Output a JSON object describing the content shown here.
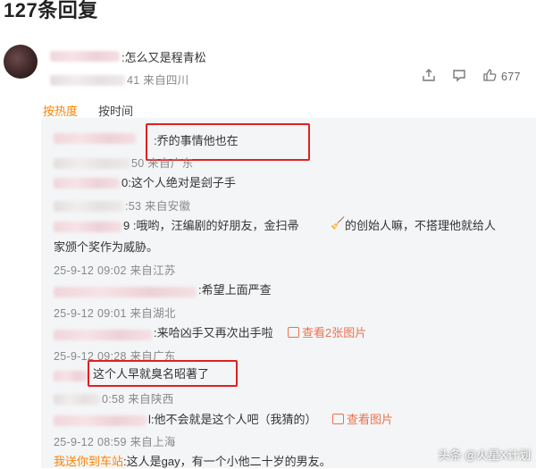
{
  "header": {
    "title": "127条回复"
  },
  "main_comment": {
    "text": ":怎么又是程青松",
    "meta": "41 来自四川",
    "like_count": "677"
  },
  "sort_tabs": {
    "hot": "按热度",
    "time": "按时间"
  },
  "replies": [
    {
      "text": ":乔的事情他也在",
      "meta": "50 来自广东"
    },
    {
      "text": "0:这个人绝对是刽子手",
      "meta": ":53 来自安徽"
    },
    {
      "text_line1": "9 :哦哟，汪编剧的好朋友，金扫帚",
      "text_line1b": "的创始人嘛，不搭理他就给人",
      "text_line2": "家颁个奖作为威胁。",
      "meta": "25-9-12 09:02 来自江苏"
    },
    {
      "text": ":希望上面严查",
      "meta": "25-9-12 09:01 来自湖北"
    },
    {
      "text": ":来哈凶手又再次出手啦",
      "link": "查看2张图片",
      "meta": "25-9-12 09:28 来自广东"
    },
    {
      "text": "这个人早就臭名昭著了",
      "meta": "0:58 来自陕西"
    },
    {
      "text": "l:他不会就是这个人吧（我猜的）",
      "link": "查看图片",
      "meta": "25-9-12 08:59 来自上海"
    },
    {
      "user": "我送你到车站",
      "text": ":这人是gay，有一个小他二十岁的男友。"
    }
  ],
  "watermark": "头条 @火星X计划"
}
